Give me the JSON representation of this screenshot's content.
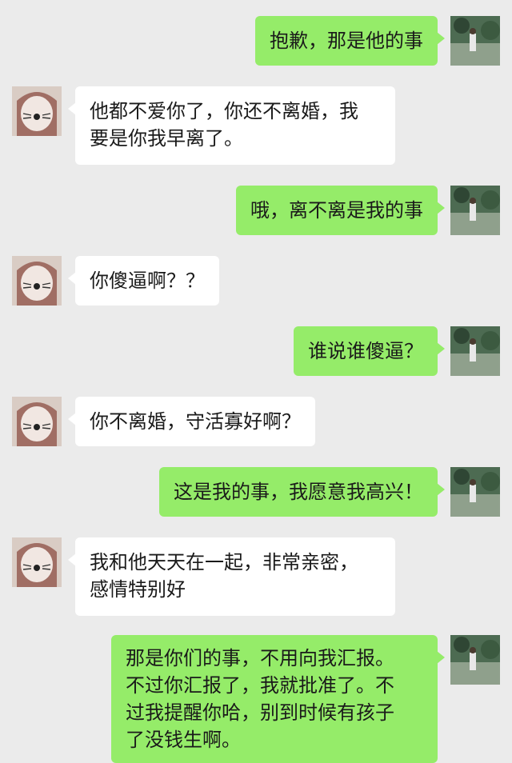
{
  "messages": [
    {
      "sender": "me",
      "lines": [
        "抱歉，那是他的事"
      ]
    },
    {
      "sender": "them",
      "lines": [
        "他都不爱你了，你还不离婚，我",
        "要是你我早离了。"
      ]
    },
    {
      "sender": "me",
      "lines": [
        "哦，离不离是我的事"
      ]
    },
    {
      "sender": "them",
      "lines": [
        "你傻逼啊？？"
      ]
    },
    {
      "sender": "me",
      "lines": [
        "谁说谁傻逼？"
      ]
    },
    {
      "sender": "them",
      "lines": [
        "你不离婚，守活寡好啊？"
      ]
    },
    {
      "sender": "me",
      "lines": [
        "这是我的事，我愿意我高兴！"
      ]
    },
    {
      "sender": "them",
      "lines": [
        "我和他天天在一起，非常亲密，",
        "感情特别好"
      ]
    },
    {
      "sender": "me",
      "lines": [
        "那是你们的事，不用向我汇报。",
        "不过你汇报了，我就批准了。不",
        "过我提醒你哈，别到时候有孩子",
        "了没钱生啊。"
      ]
    }
  ],
  "colors": {
    "background": "#ebebeb",
    "my_bubble": "#95ec69",
    "their_bubble": "#ffffff"
  },
  "avatars": {
    "me": "photo-avatar-icon",
    "them": "cat-face-avatar-icon"
  }
}
